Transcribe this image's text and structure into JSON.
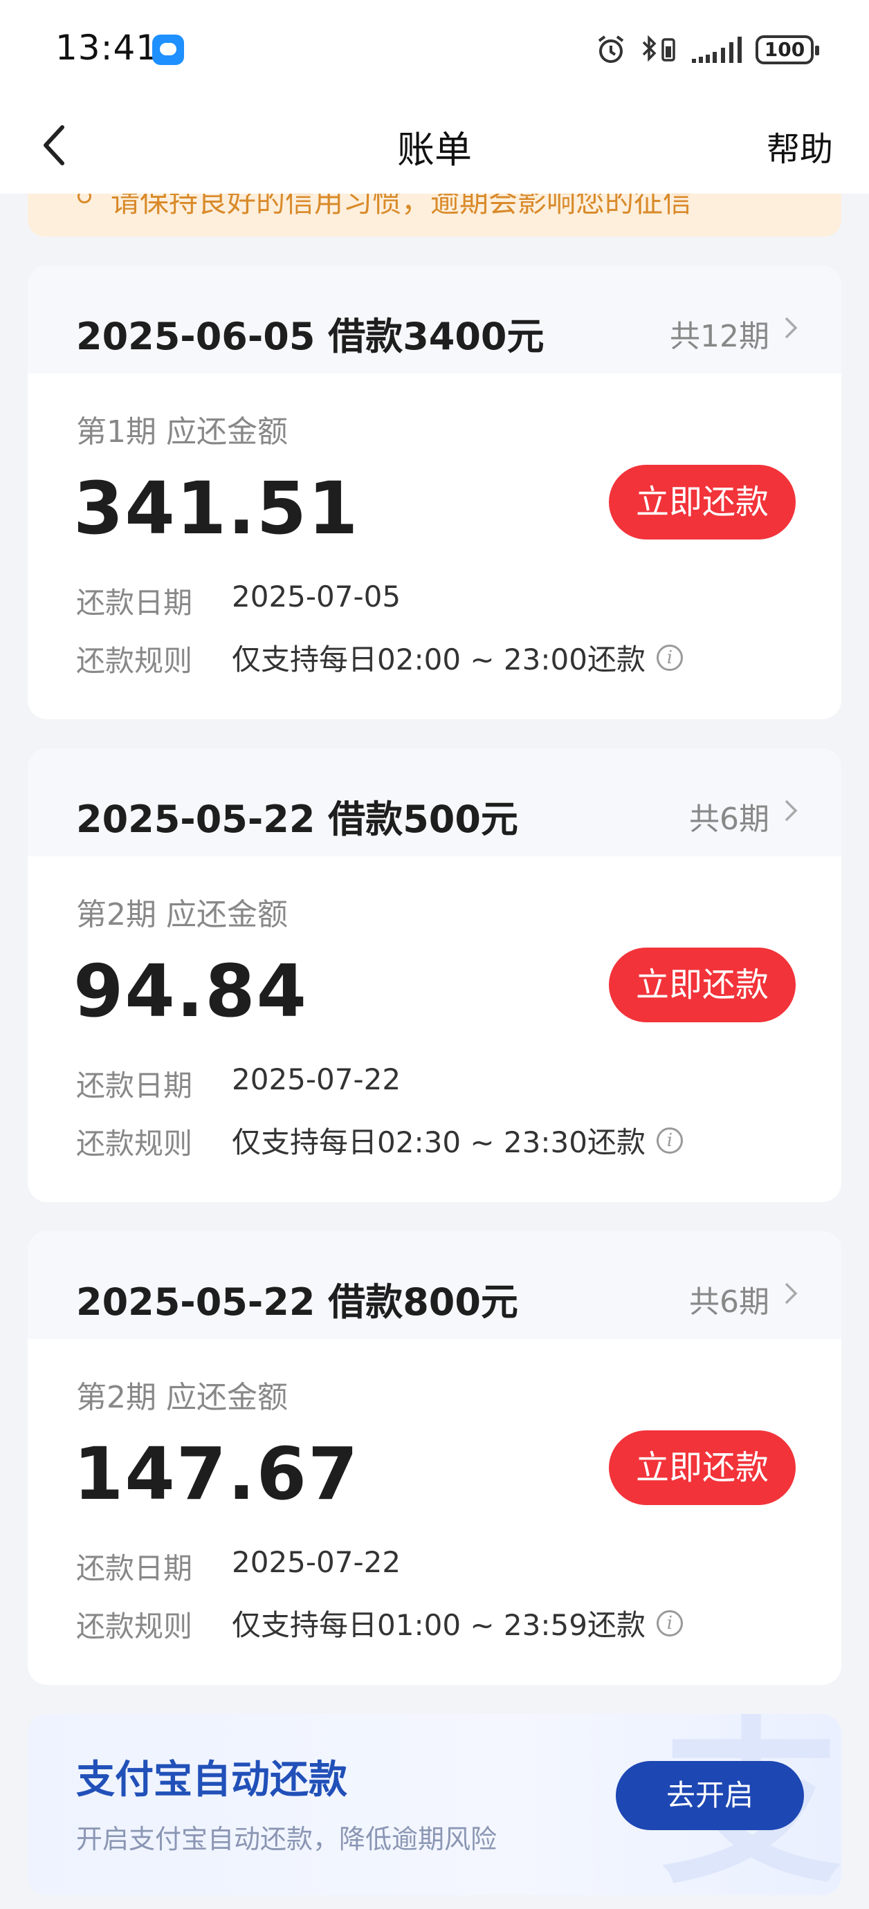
{
  "status_bar": {
    "time": "13:41",
    "battery": "100"
  },
  "nav": {
    "title": "账单",
    "help": "帮助"
  },
  "notice": {
    "text": "请保持良好的信用习惯，逾期会影响您的征信"
  },
  "bills": [
    {
      "title": "2025-06-05 借款3400元",
      "periods": "共12期",
      "installment_label": "第1期  应还金额",
      "amount": "341.51",
      "button": "立即还款",
      "date_label": "还款日期",
      "date": "2025-07-05",
      "rule_label": "还款规则",
      "rule": "仅支持每日02:00 ~ 23:00还款"
    },
    {
      "title": "2025-05-22 借款500元",
      "periods": "共6期",
      "installment_label": "第2期  应还金额",
      "amount": "94.84",
      "button": "立即还款",
      "date_label": "还款日期",
      "date": "2025-07-22",
      "rule_label": "还款规则",
      "rule": "仅支持每日02:30 ~ 23:30还款"
    },
    {
      "title": "2025-05-22 借款800元",
      "periods": "共6期",
      "installment_label": "第2期  应还金额",
      "amount": "147.67",
      "button": "立即还款",
      "date_label": "还款日期",
      "date": "2025-07-22",
      "rule_label": "还款规则",
      "rule": "仅支持每日01:00 ~ 23:59还款"
    }
  ],
  "auto_repay": {
    "title": "支付宝自动还款",
    "subtitle": "开启支付宝自动还款，降低逾期风险",
    "button": "去开启",
    "watermark": "支"
  },
  "colors": {
    "accent_red": "#f2333a",
    "brand_blue": "#1d47b3",
    "notice_orange": "#d98a2a"
  }
}
